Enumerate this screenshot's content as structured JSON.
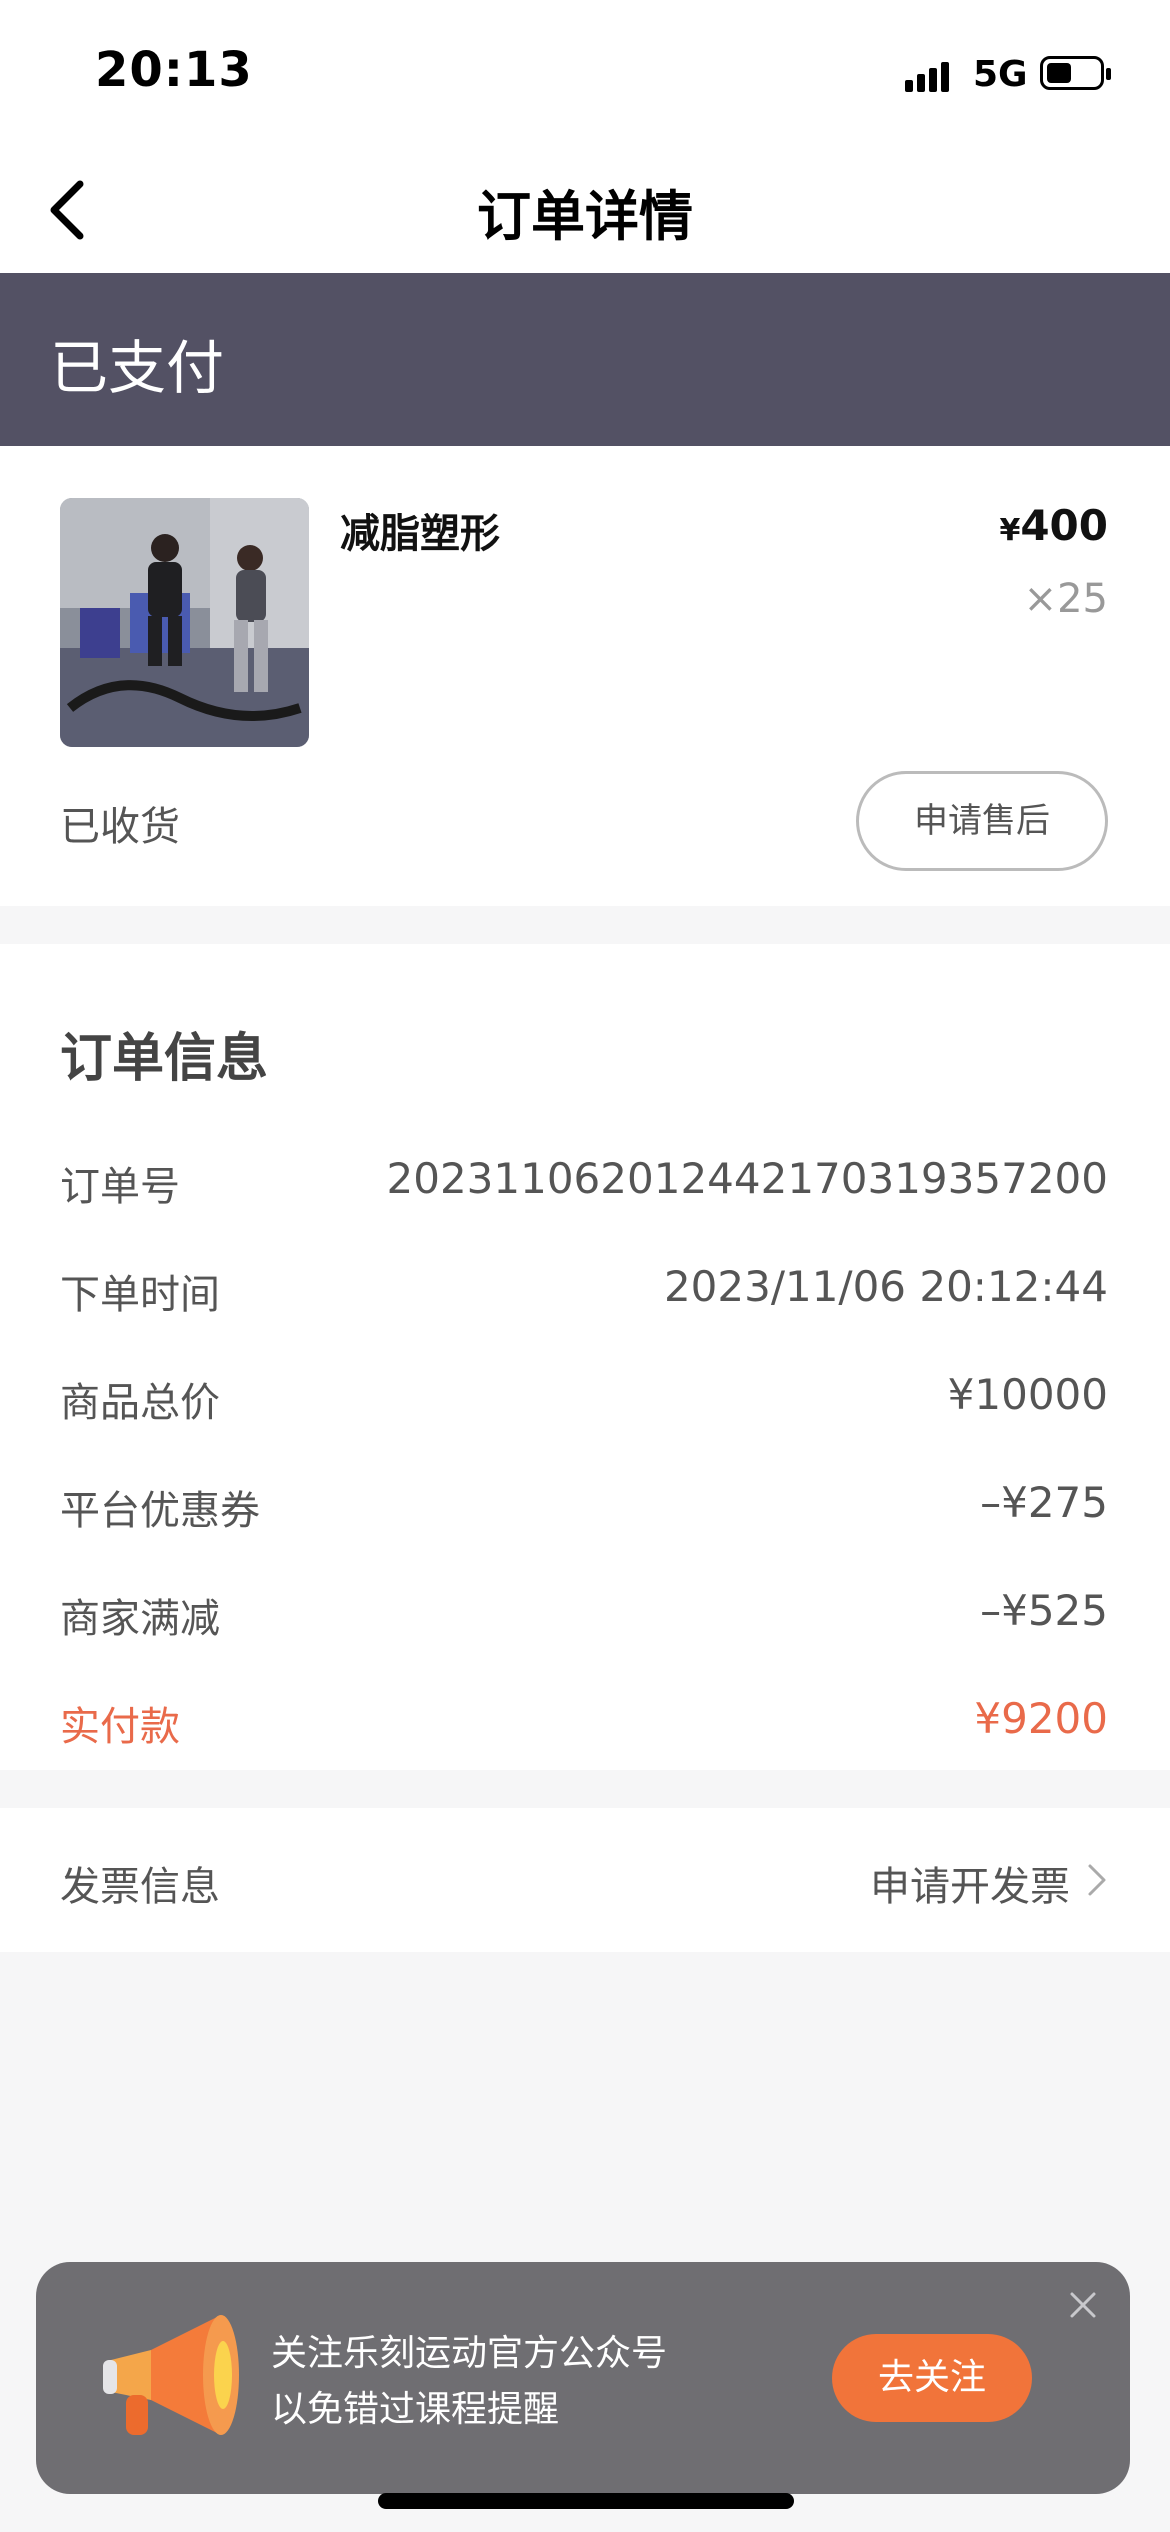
{
  "status_bar": {
    "time": "20:13",
    "network": "5G"
  },
  "nav": {
    "title": "订单详情"
  },
  "order_status": "已支付",
  "product": {
    "name": "减脂塑形",
    "price_symbol": "¥",
    "price": "400",
    "quantity": "×25",
    "delivery_status": "已收货",
    "after_sale_button": "申请售后"
  },
  "order_info": {
    "title": "订单信息",
    "rows": [
      {
        "label": "订单号",
        "value": "20231106201244217031935​7200"
      },
      {
        "label": "下单时间",
        "value": "2023/11/06 20:12:44"
      },
      {
        "label": "商品总价",
        "value": "¥10000"
      },
      {
        "label": "平台优惠券",
        "value": "–¥275"
      },
      {
        "label": "商家满减",
        "value": "–¥525"
      },
      {
        "label": "实付款",
        "value": "¥9200"
      }
    ]
  },
  "invoice": {
    "label": "发票信息",
    "action": "申请开发票"
  },
  "toast": {
    "line1": "关注乐刻运动官方公众号",
    "line2": "以免错过课程提醒",
    "button": "去关注"
  },
  "colors": {
    "banner": "#535164",
    "accent_red": "#e96a4a",
    "follow_orange": "#f1743a"
  }
}
